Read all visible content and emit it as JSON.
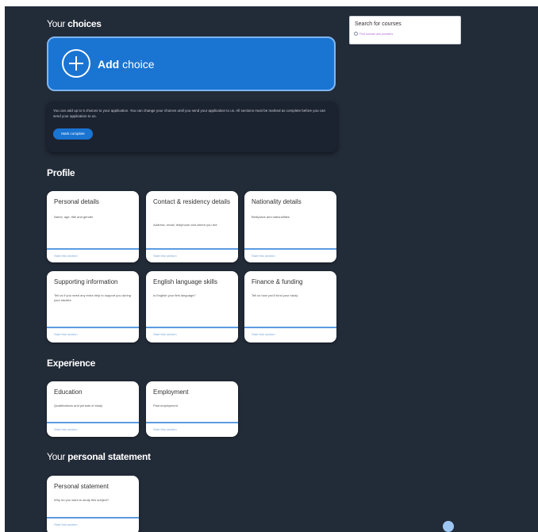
{
  "choices": {
    "heading_prefix": "Your ",
    "heading_bold": "choices",
    "add_bold": "Add",
    "add_rest": " choice",
    "info_text": "You can add up to 5 choices to your application. You can change your choices until you send your application to us. All sections must be marked as complete before you can send your application to us.",
    "info_button": "Mark complete"
  },
  "search": {
    "title": "Search for courses",
    "link": "Find courses and providers"
  },
  "profile": {
    "heading": "Profile",
    "cards": [
      {
        "title": "Personal details",
        "desc": "Name, age, title and gender",
        "link": "Start this section"
      },
      {
        "title": "Contact & residency details",
        "desc": "Address, email, telephone and where you live",
        "link": "Start this section"
      },
      {
        "title": "Nationality details",
        "desc": "Birthplace and nationalities",
        "link": "Start this section"
      },
      {
        "title": "Supporting information",
        "desc": "Tell us if you need any extra help to support you during your studies",
        "link": "Start this section"
      },
      {
        "title": "English language skills",
        "desc": "Is English your first language?",
        "link": "Start this section"
      },
      {
        "title": "Finance & funding",
        "desc": "Tell us how you'll fund your study",
        "link": "Start this section"
      }
    ]
  },
  "experience": {
    "heading": "Experience",
    "cards": [
      {
        "title": "Education",
        "desc": "Qualifications and periods of study",
        "link": "Start this section"
      },
      {
        "title": "Employment",
        "desc": "Paid employment",
        "link": "Start this section"
      }
    ]
  },
  "statement": {
    "heading_prefix": "Your ",
    "heading_bold": "personal statement",
    "cards": [
      {
        "title": "Personal statement",
        "desc": "Why do you want to study this subject?",
        "link": "Start this section"
      }
    ]
  },
  "colors": {
    "background": "#222b38",
    "accent": "#1a74d2"
  }
}
